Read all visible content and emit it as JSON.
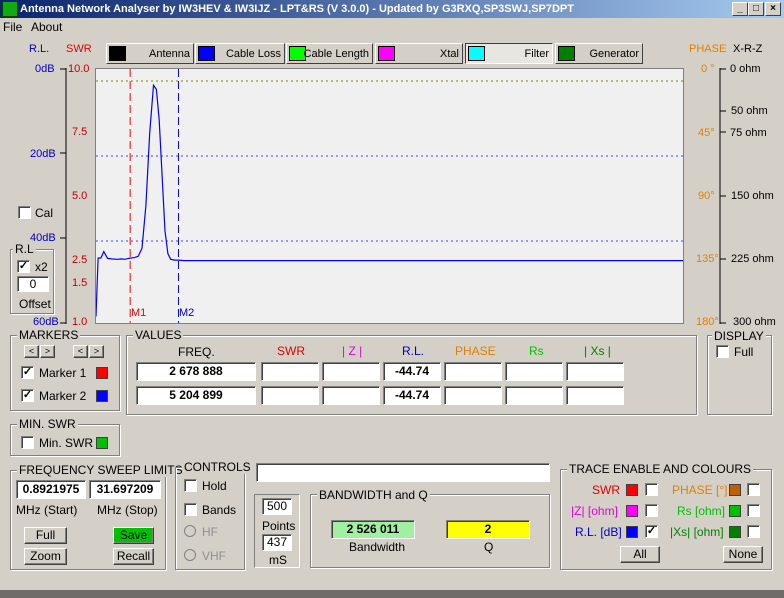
{
  "window": {
    "title": "Antenna Network Analyser by IW3HEV & IW3IJZ - LPT&RS (V 3.0.0) - Updated by G3RXQ,SP3SWJ,SP7DPT"
  },
  "menu": {
    "file": "File",
    "about": "About"
  },
  "tabs": [
    {
      "label": "Antenna",
      "icon": "antenna-icon",
      "color": "#000000"
    },
    {
      "label": "Cable Loss",
      "icon": "cable-loss-icon",
      "color": "#0000ff"
    },
    {
      "label": "Cable Length",
      "icon": "cable-length-icon",
      "color": "#00ff00"
    },
    {
      "label": "Xtal",
      "icon": "xtal-icon",
      "color": "#ff00ff"
    },
    {
      "label": "Filter",
      "icon": "filter-icon",
      "color": "#00ffff"
    },
    {
      "label": "Generator",
      "icon": "generator-icon",
      "color": "#008000"
    }
  ],
  "left_axes": {
    "rl_header": "R.L.",
    "swr_header": "SWR",
    "rl_ticks": [
      "0dB",
      "20dB",
      "40dB",
      "60dB"
    ],
    "swr_ticks": [
      "10.0",
      "7.5",
      "5.0",
      "2.5",
      "1.5",
      "1.0"
    ]
  },
  "right_axes": {
    "phase_header": "PHASE",
    "xrz_header": "X-R-Z",
    "phase_ticks": [
      "0 °",
      "45°",
      "90°",
      "135°",
      "180°"
    ],
    "ohm_ticks": [
      "0 ohm",
      "50 ohm",
      "75 ohm",
      "150 ohm",
      "225 ohm",
      "300 ohm"
    ]
  },
  "cal": {
    "label": "Cal",
    "checked": false
  },
  "rl_group": {
    "label": "R.L",
    "x2_label": "x2",
    "x2_checked": true,
    "offset_value": "0",
    "offset_label": "Offset"
  },
  "markers": {
    "label": "MARKERS",
    "marker1": "Marker 1",
    "marker2": "Marker 2",
    "m1": "M1",
    "m2": "M2",
    "marker1_color": "#ff0000",
    "marker2_color": "#0000ff"
  },
  "values": {
    "label": "VALUES",
    "headers": {
      "freq": "FREQ.",
      "swr": "SWR",
      "z": "| Z |",
      "rl": "R.L.",
      "phase": "PHASE",
      "rs": "Rs",
      "xs": "| Xs |"
    },
    "rows": [
      {
        "freq": "2 678 888",
        "swr": "",
        "z": "",
        "rl": "-44.74",
        "phase": "",
        "rs": "",
        "xs": ""
      },
      {
        "freq": "5 204 899",
        "swr": "",
        "z": "",
        "rl": "-44.74",
        "phase": "",
        "rs": "",
        "xs": ""
      }
    ]
  },
  "display": {
    "label": "DISPLAY",
    "full": "Full"
  },
  "min_swr": {
    "label": "MIN. SWR",
    "checkbox": "Min. SWR",
    "color": "#00c000"
  },
  "sweep": {
    "label": "FREQUENCY SWEEP LIMITS",
    "start": "0.8921975",
    "stop": "31.697209",
    "start_label": "MHz (Start)",
    "stop_label": "MHz (Stop)",
    "full": "Full",
    "save": "Save",
    "zoom": "Zoom",
    "recall": "Recall"
  },
  "controls": {
    "label": "CONTROLS",
    "hold": "Hold",
    "bands": "Bands",
    "hf": "HF",
    "vhf": "VHF"
  },
  "points": {
    "value": "500",
    "label": "Points",
    "ms_value": "437",
    "ms_label": "mS"
  },
  "status_text": "",
  "bandwidth": {
    "label": "BANDWIDTH and Q",
    "bw_value": "2 526 011",
    "bw_label": "Bandwidth",
    "q_value": "2",
    "q_label": "Q"
  },
  "trace": {
    "label": "TRACE ENABLE AND COLOURS",
    "swr": "SWR",
    "z": "|Z| [ohm]",
    "rl": "R.L. [dB]",
    "phase": "PHASE [°]",
    "rs": "Rs [ohm]",
    "xs": "|Xs| [ohm]",
    "all": "All",
    "none": "None",
    "colors": {
      "swr": "#ff0000",
      "z": "#ff00ff",
      "rl": "#0000ff",
      "phase": "#c06000",
      "rs": "#00c000",
      "xs": "#008000"
    }
  },
  "chart_data": {
    "type": "line",
    "title": "",
    "xlim": [
      0.8921975,
      31.697209
    ],
    "xlabel": "",
    "ylabel": "R.L.",
    "ylim_db": [
      0,
      60
    ],
    "series": [
      {
        "name": "R.L. [dB]",
        "color": "#0000ff",
        "x": [
          0.89,
          1.0,
          1.15,
          1.3,
          1.5,
          1.7,
          2.0,
          2.2,
          2.4,
          2.6,
          2.9,
          3.1,
          3.3,
          3.5,
          3.7,
          3.9,
          4.05,
          4.2,
          4.35,
          4.5,
          4.65,
          4.8,
          5.0,
          5.2,
          5.5,
          6.0,
          8.0,
          12.0,
          16.0,
          20.0,
          24.0,
          28.0,
          31.7
        ],
        "y": [
          58,
          44.3,
          44.3,
          42.8,
          44.4,
          44.5,
          44.6,
          44.5,
          44.6,
          44.4,
          44.2,
          43.9,
          42.0,
          32.0,
          15.0,
          3.8,
          4.8,
          12.0,
          25.0,
          38.0,
          43.3,
          44.6,
          44.8,
          44.8,
          44.9,
          44.9,
          44.9,
          44.9,
          44.9,
          44.9,
          44.9,
          44.9,
          44.9
        ]
      }
    ],
    "markers": [
      {
        "name": "M1",
        "x": 2.678888
      },
      {
        "name": "M2",
        "x": 5.204899
      }
    ],
    "grid": true
  }
}
